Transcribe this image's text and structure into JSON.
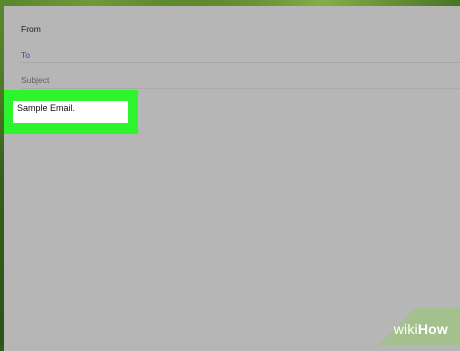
{
  "email_form": {
    "from_label": "From",
    "to_label": "To",
    "subject_label": "Subject",
    "body_text": "Sample Email."
  },
  "watermark": {
    "prefix": "wiki",
    "suffix": "How"
  },
  "colors": {
    "highlight": "#2df52d",
    "to_label": "#3a4a8c",
    "panel": "#b6b6b6"
  }
}
